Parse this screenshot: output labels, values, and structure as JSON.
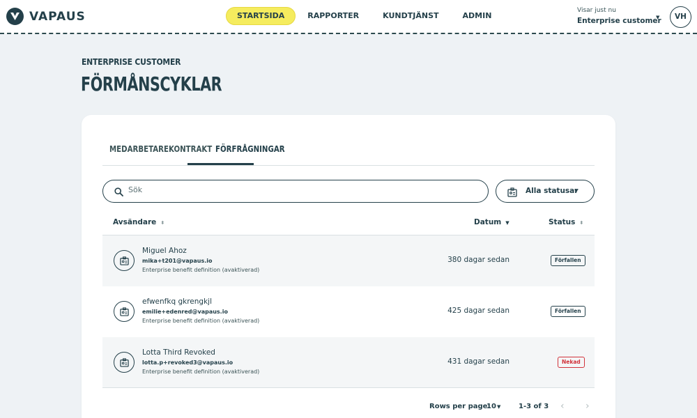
{
  "header": {
    "logo_text": "VAPAUS",
    "nav": [
      {
        "label": "STARTSIDA",
        "active": true
      },
      {
        "label": "RAPPORTER",
        "active": false
      },
      {
        "label": "KUNDTJÄNST",
        "active": false
      },
      {
        "label": "ADMIN",
        "active": false
      }
    ],
    "viewing_label": "Visar just nu",
    "viewing_value": "Enterprise customer",
    "avatar_initials": "VH"
  },
  "page": {
    "eyebrow": "ENTERPRISE CUSTOMER",
    "title": "FÖRMÅNSCYKLAR"
  },
  "tabs": [
    {
      "label": "MEDARBETARE",
      "active": false
    },
    {
      "label": "KONTRAKT",
      "active": false
    },
    {
      "label": "FÖRFRÅGNINGAR",
      "active": true
    }
  ],
  "search": {
    "placeholder": "Sök",
    "value": ""
  },
  "filter": {
    "label": "Alla statusar"
  },
  "table": {
    "columns": {
      "sender": "Avsändare",
      "date": "Datum",
      "status": "Status"
    },
    "rows": [
      {
        "name": "Miguel Ahoz",
        "email": "mika+t201@vapaus.io",
        "description": "Enterprise benefit definition (avaktiverad)",
        "date": "380 dagar sedan",
        "status": "Förfallen",
        "status_type": "neutral"
      },
      {
        "name": "efwenfkq gkrengkjl",
        "email": "emilie+edenred@vapaus.io",
        "description": "Enterprise benefit definition (avaktiverad)",
        "date": "425 dagar sedan",
        "status": "Förfallen",
        "status_type": "neutral"
      },
      {
        "name": "Lotta Third Revoked",
        "email": "lotta.p+revoked3@vapaus.io",
        "description": "Enterprise benefit definition (avaktiverad)",
        "date": "431 dagar sedan",
        "status": "Nekad",
        "status_type": "negative"
      }
    ]
  },
  "pagination": {
    "rows_per_page_label": "Rows per page:",
    "rows_per_page": "10",
    "range": "1-3 of 3"
  },
  "colors": {
    "accent": "#24404a",
    "highlight": "#f5ec5e",
    "negative": "#d1323a",
    "background": "#eef2f5"
  }
}
